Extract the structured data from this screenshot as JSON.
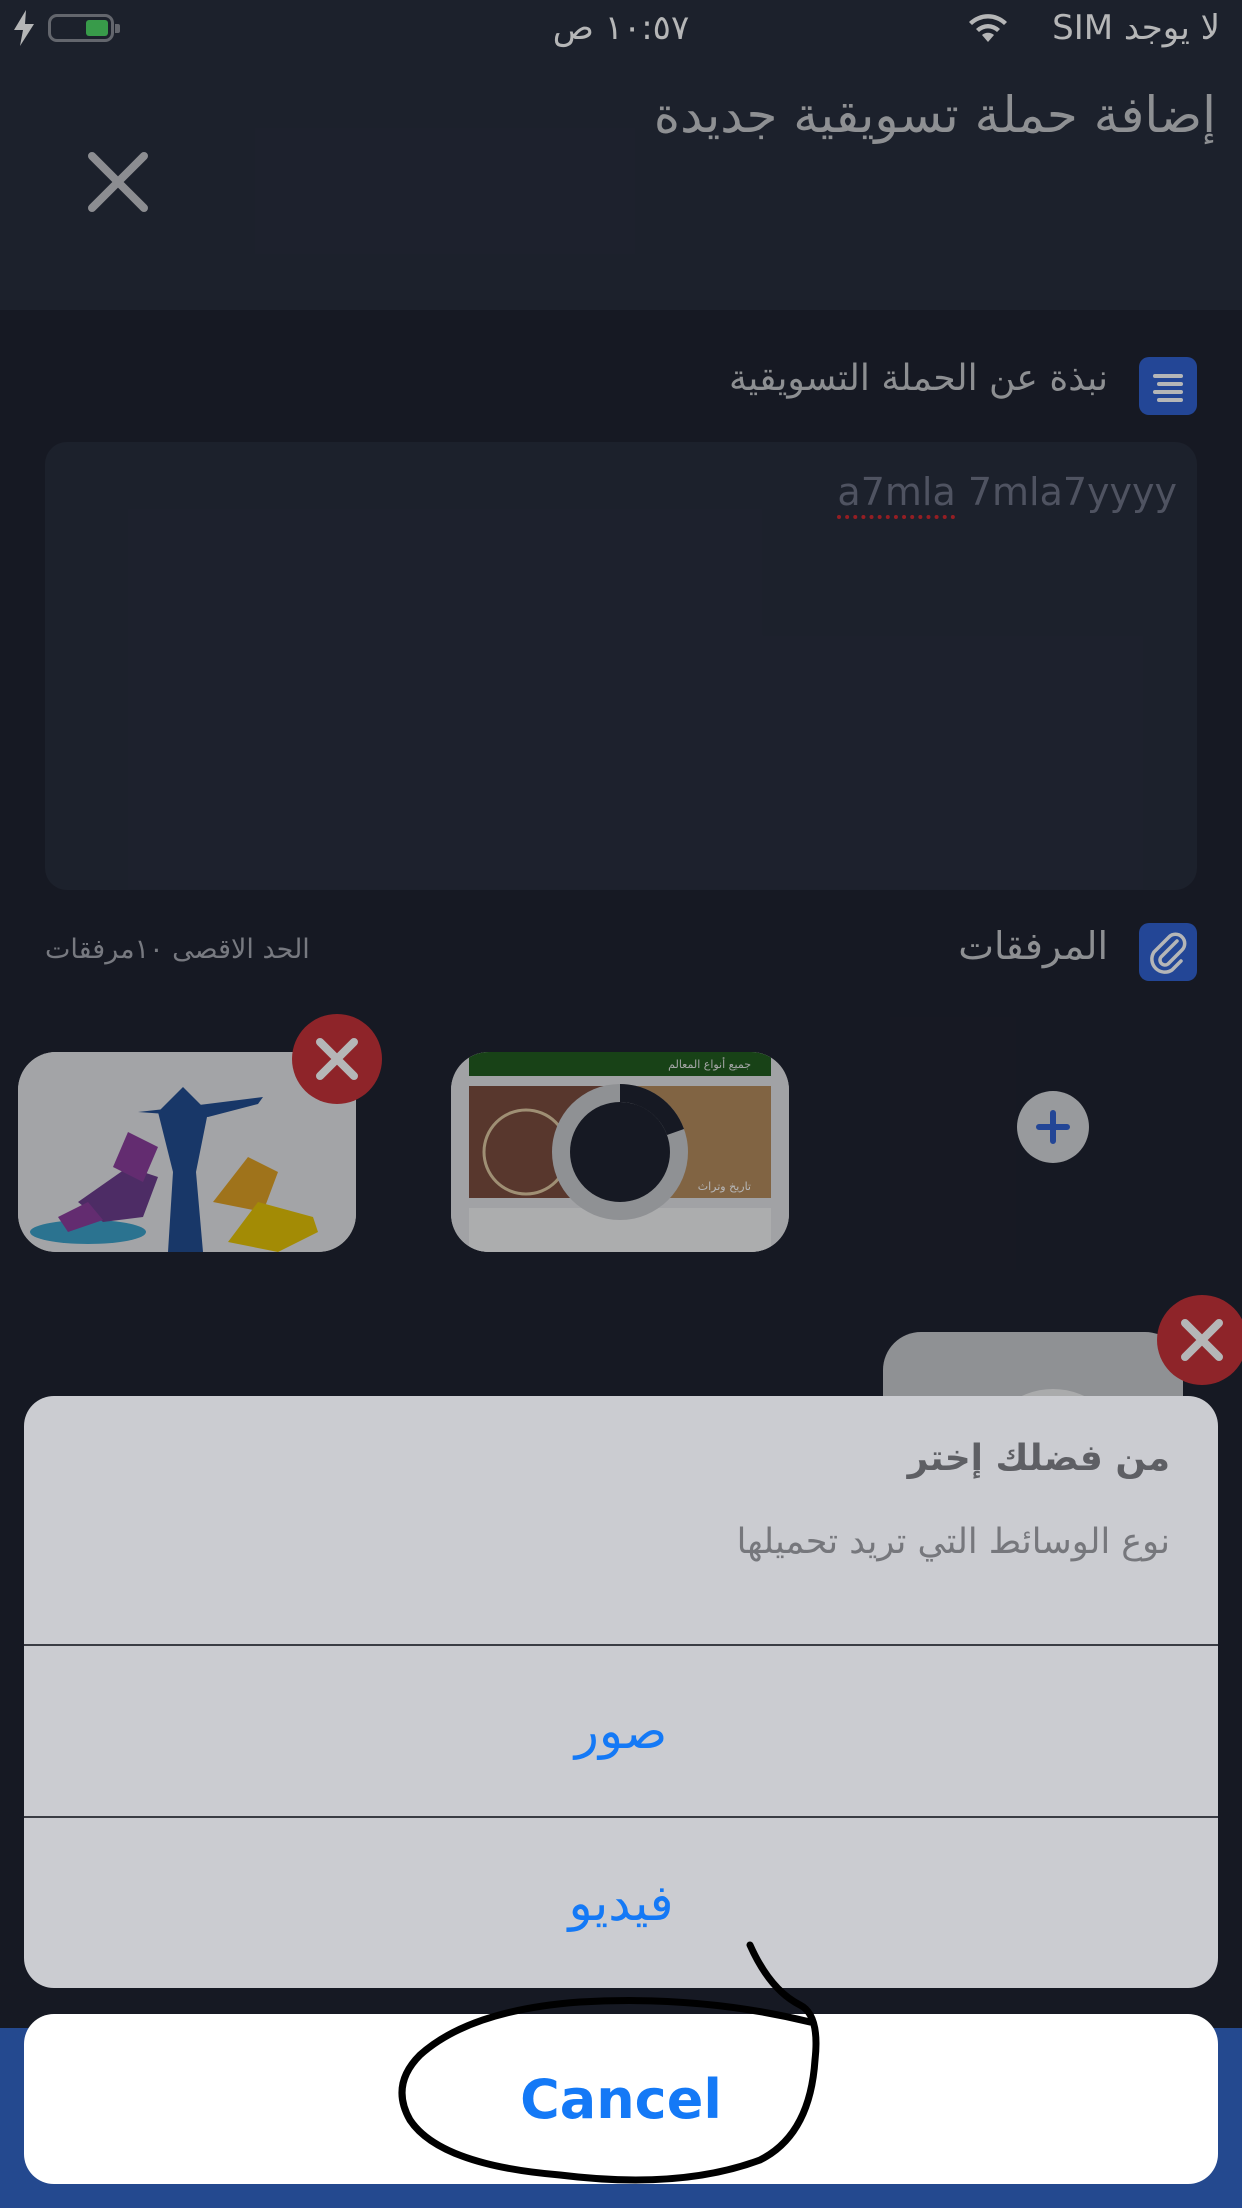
{
  "status_bar": {
    "carrier": "لا يوجد SIM",
    "time": "١٠:٥٧ ص",
    "icons": [
      "charging-bolt-icon",
      "battery-icon",
      "wifi-icon"
    ]
  },
  "header": {
    "title": "إضافة حملة تسويقية جديدة",
    "close_icon": "close-icon"
  },
  "about": {
    "label": "نبذة عن الحملة التسويقية",
    "icon": "text-lines-icon",
    "text_part1": "a7mla",
    "text_part2": " 7mla7yyyy"
  },
  "attachments": {
    "label": "المرفقات",
    "icon": "paperclip-icon",
    "max_label": "الحد الاقصى ١٠مرفقات",
    "thumb2_top_caption": "جميع أنواع المعالم",
    "thumb2_bottom_caption": "تاريخ وتراث",
    "add_icon": "plus-icon",
    "remove_icon": "remove-x-icon"
  },
  "action_sheet": {
    "title": "من فضلك إختر",
    "message": "نوع الوسائط التي تريد تحميلها",
    "options": [
      "صور",
      "فيديو"
    ],
    "cancel": "Cancel"
  },
  "colors": {
    "accent_blue": "#1479f6",
    "remove_red": "#c82f34",
    "section_icon_blue": "#2e5fd0",
    "background": "#1c1f2b"
  }
}
